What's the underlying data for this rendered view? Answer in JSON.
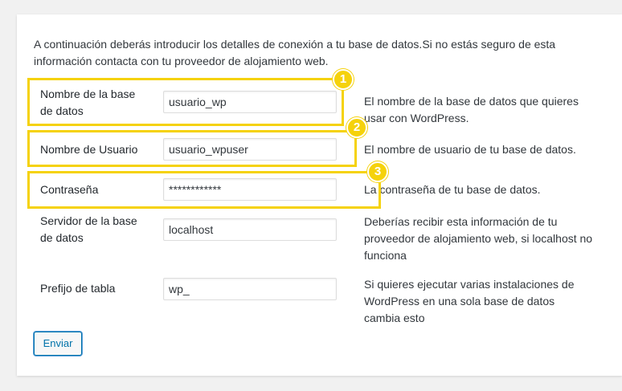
{
  "intro": "A continuación deberás introducir los detalles de conexión a tu base de datos.Si no estás seguro de esta información contacta con tu proveedor de alojamiento web.",
  "fields": [
    {
      "label": "Nombre de la base de datos",
      "value": "usuario_wp",
      "description": "El nombre de la base de datos que quieres usar con WordPress."
    },
    {
      "label": "Nombre de Usuario",
      "value": "usuario_wpuser",
      "description": "El nombre de usuario de tu base de datos."
    },
    {
      "label": "Contraseña",
      "value": "************",
      "description": "La contraseña de tu base de datos."
    },
    {
      "label": "Servidor de la base de datos",
      "value": "localhost",
      "description_pre": "Deberías recibir esta información de tu proveedor de alojamiento web, si",
      "description_code": "localhost",
      "description_post": "no funciona"
    },
    {
      "label": "Prefijo de tabla",
      "value": "wp_",
      "description": "Si quieres ejecutar varias instalaciones de WordPress en una sola base de datos cambia esto"
    }
  ],
  "badges": [
    "1",
    "2",
    "3"
  ],
  "submit_label": "Enviar",
  "highlight_color": "#f5d20c",
  "accent_color": "#0073aa"
}
